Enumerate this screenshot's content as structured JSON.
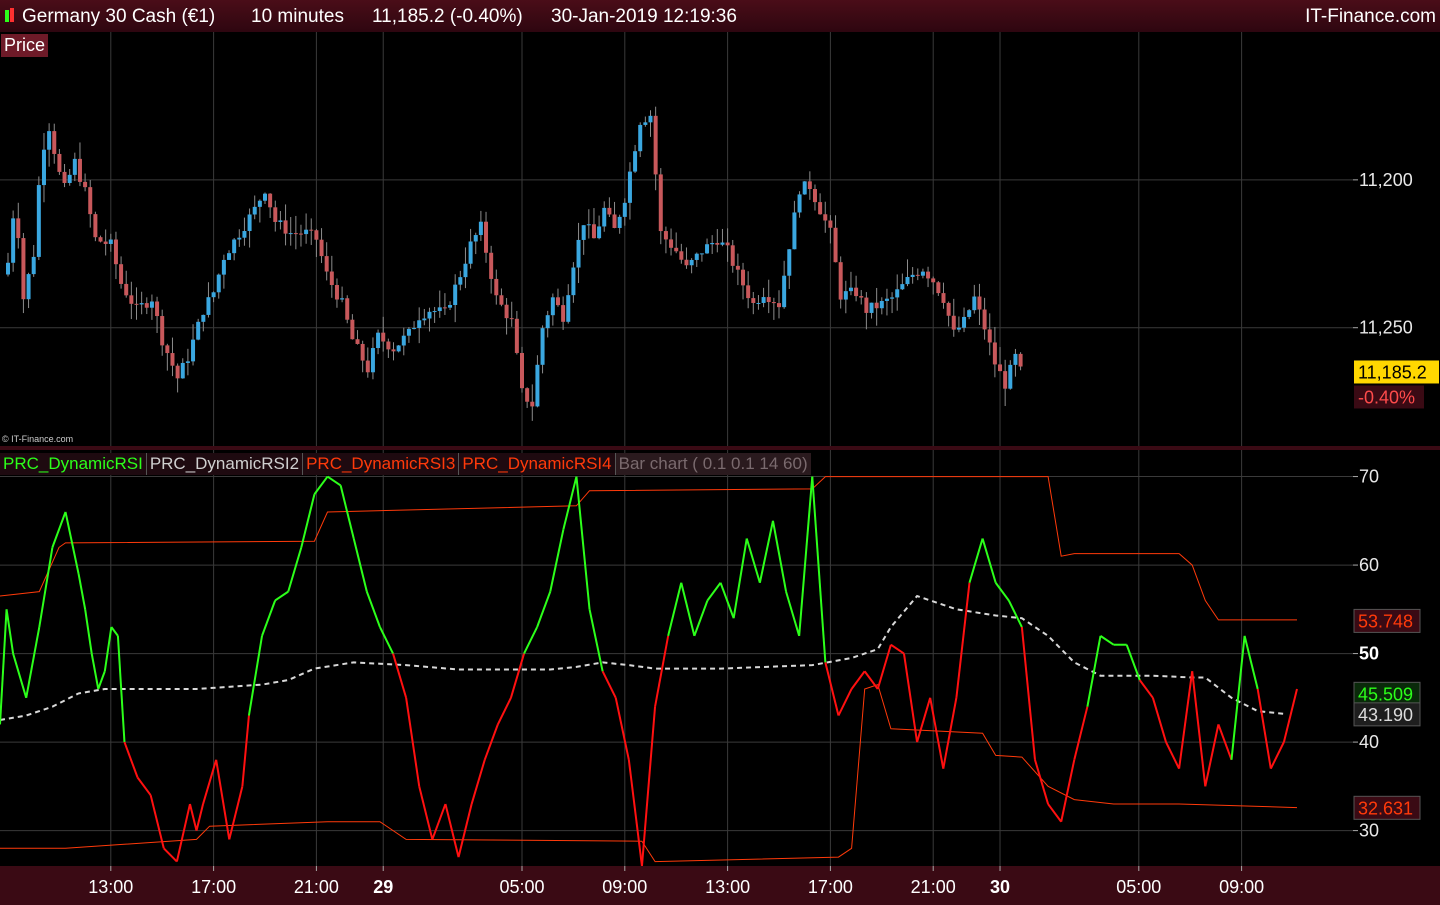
{
  "header": {
    "instrument": "Germany 30 Cash (€1)",
    "interval": "10 minutes",
    "last": "11,185.2 (-0.40%)",
    "datetime": "30-Jan-2019 12:19:36",
    "brand": "IT-Finance.com"
  },
  "price_panel": {
    "label": "Price",
    "watermark": "© IT-Finance.com",
    "axis_ticks": [
      "11,250",
      "11,200"
    ],
    "last_price_tag": "11,185.2",
    "change_tag": "-0.40%"
  },
  "indicator_panel": {
    "tabs": [
      "PRC_DynamicRSI",
      "PRC_DynamicRSI2",
      "PRC_DynamicRSI3",
      "PRC_DynamicRSI4",
      "Bar chart ( 0.1 0.1 14 60)"
    ],
    "axis_ticks": [
      "70",
      "60",
      "50",
      "40",
      "30"
    ],
    "value_tags": {
      "upper": "53.748",
      "rsi": "45.509",
      "mid": "43.190",
      "lower": "32.631"
    }
  },
  "x_axis": {
    "labels": [
      "13:00",
      "17:00",
      "21:00",
      "29",
      "05:00",
      "09:00",
      "13:00",
      "17:00",
      "21:00",
      "30",
      "05:00",
      "09:00"
    ],
    "bold": [
      false,
      false,
      false,
      true,
      false,
      false,
      false,
      false,
      false,
      true,
      false,
      false
    ]
  },
  "colors": {
    "up": "#3aa7e0",
    "down": "#c8585b",
    "wick": "#8c8c8c",
    "rsi_bull": "#2cff1a",
    "rsi_bear": "#ff1010",
    "band": "#ff3a0a",
    "mid": "#d8d8d8",
    "tag_last": "#ffd700",
    "tag_change": "#ff4b4b"
  },
  "chart_data": [
    {
      "type": "candlestick",
      "title": "Germany 30 Cash (€1)",
      "y_ticks": [
        11200,
        11250
      ],
      "ylim": [
        11160,
        11300
      ],
      "last": 11185.2,
      "change_pct": -0.4,
      "close_path": [
        [
          0,
          11222
        ],
        [
          1,
          11238
        ],
        [
          2,
          11232
        ],
        [
          3,
          11210
        ],
        [
          5,
          11225
        ],
        [
          6,
          11248
        ],
        [
          7,
          11262
        ],
        [
          8,
          11268
        ],
        [
          10,
          11252
        ],
        [
          11,
          11247
        ],
        [
          13,
          11256
        ],
        [
          15,
          11246
        ],
        [
          17,
          11230
        ],
        [
          20,
          11228
        ],
        [
          22,
          11215
        ],
        [
          25,
          11206
        ],
        [
          28,
          11210
        ],
        [
          30,
          11196
        ],
        [
          33,
          11183
        ],
        [
          35,
          11190
        ],
        [
          38,
          11206
        ],
        [
          40,
          11212
        ],
        [
          42,
          11224
        ],
        [
          45,
          11232
        ],
        [
          48,
          11240
        ],
        [
          50,
          11247
        ],
        [
          52,
          11236
        ],
        [
          55,
          11232
        ],
        [
          58,
          11232
        ],
        [
          60,
          11230
        ],
        [
          62,
          11218
        ],
        [
          65,
          11208
        ],
        [
          67,
          11196
        ],
        [
          70,
          11186
        ],
        [
          72,
          11197
        ],
        [
          75,
          11193
        ],
        [
          78,
          11198
        ],
        [
          80,
          11204
        ],
        [
          82,
          11206
        ],
        [
          85,
          11205
        ],
        [
          88,
          11218
        ],
        [
          90,
          11228
        ],
        [
          92,
          11234
        ],
        [
          95,
          11210
        ],
        [
          98,
          11202
        ],
        [
          100,
          11178
        ],
        [
          102,
          11174
        ],
        [
          104,
          11200
        ],
        [
          106,
          11210
        ],
        [
          108,
          11204
        ],
        [
          110,
          11222
        ],
        [
          112,
          11236
        ],
        [
          114,
          11230
        ],
        [
          116,
          11240
        ],
        [
          118,
          11233
        ],
        [
          120,
          11244
        ],
        [
          123,
          11270
        ],
        [
          125,
          11272
        ],
        [
          127,
          11232
        ],
        [
          130,
          11226
        ],
        [
          132,
          11220
        ],
        [
          135,
          11226
        ],
        [
          138,
          11230
        ],
        [
          140,
          11226
        ],
        [
          142,
          11218
        ],
        [
          145,
          11208
        ],
        [
          147,
          11212
        ],
        [
          150,
          11208
        ],
        [
          152,
          11228
        ],
        [
          154,
          11247
        ],
        [
          156,
          11248
        ],
        [
          158,
          11240
        ],
        [
          160,
          11232
        ],
        [
          162,
          11211
        ],
        [
          165,
          11212
        ],
        [
          167,
          11206
        ],
        [
          170,
          11208
        ],
        [
          172,
          11210
        ],
        [
          174,
          11214
        ],
        [
          176,
          11218
        ],
        [
          178,
          11220
        ],
        [
          180,
          11216
        ],
        [
          182,
          11210
        ],
        [
          184,
          11198
        ],
        [
          186,
          11202
        ],
        [
          188,
          11210
        ],
        [
          190,
          11200
        ],
        [
          192,
          11188
        ],
        [
          194,
          11181
        ],
        [
          196,
          11190
        ],
        [
          197,
          11185.2
        ]
      ]
    },
    {
      "type": "line",
      "title": "PRC_DynamicRSI",
      "y_ticks": [
        30,
        40,
        50,
        60,
        70
      ],
      "ylim": [
        26,
        73
      ],
      "series": [
        {
          "name": "PRC_DynamicRSI",
          "role": "rsi",
          "values": [
            [
              0,
              42
            ],
            [
              1,
              55
            ],
            [
              2,
              50
            ],
            [
              4,
              45
            ],
            [
              6,
              53
            ],
            [
              8,
              62
            ],
            [
              10,
              66
            ],
            [
              12,
              59
            ],
            [
              13,
              55
            ],
            [
              14,
              50
            ],
            [
              15,
              46
            ],
            [
              16,
              48
            ],
            [
              17,
              53
            ],
            [
              18,
              52
            ],
            [
              19,
              40
            ],
            [
              21,
              36
            ],
            [
              23,
              34
            ],
            [
              25,
              28
            ],
            [
              27,
              26.5
            ],
            [
              29,
              33
            ],
            [
              30,
              30
            ],
            [
              31,
              33
            ],
            [
              33,
              38
            ],
            [
              35,
              29
            ],
            [
              37,
              35
            ],
            [
              38,
              43
            ],
            [
              40,
              52
            ],
            [
              42,
              56
            ],
            [
              44,
              57
            ],
            [
              46,
              62
            ],
            [
              48,
              68
            ],
            [
              50,
              70
            ],
            [
              52,
              69
            ],
            [
              54,
              63
            ],
            [
              56,
              57
            ],
            [
              58,
              53
            ],
            [
              60,
              50
            ],
            [
              62,
              45
            ],
            [
              64,
              35
            ],
            [
              66,
              29
            ],
            [
              68,
              33
            ],
            [
              70,
              27
            ],
            [
              72,
              33
            ],
            [
              74,
              38
            ],
            [
              76,
              42
            ],
            [
              78,
              45
            ],
            [
              80,
              50
            ],
            [
              82,
              53
            ],
            [
              84,
              57
            ],
            [
              86,
              64
            ],
            [
              88,
              70
            ],
            [
              90,
              55
            ],
            [
              92,
              48
            ],
            [
              94,
              45
            ],
            [
              96,
              38
            ],
            [
              98,
              26
            ],
            [
              100,
              44
            ],
            [
              102,
              52
            ],
            [
              104,
              58
            ],
            [
              106,
              52
            ],
            [
              108,
              56
            ],
            [
              110,
              58
            ],
            [
              112,
              54
            ],
            [
              114,
              63
            ],
            [
              116,
              58
            ],
            [
              118,
              65
            ],
            [
              120,
              57
            ],
            [
              122,
              52
            ],
            [
              124,
              70
            ],
            [
              126,
              49
            ],
            [
              128,
              43
            ],
            [
              130,
              46
            ],
            [
              132,
              48
            ],
            [
              134,
              46
            ],
            [
              136,
              51
            ],
            [
              138,
              50
            ],
            [
              140,
              40
            ],
            [
              142,
              45
            ],
            [
              144,
              37
            ],
            [
              146,
              45
            ],
            [
              148,
              58
            ],
            [
              150,
              63
            ],
            [
              152,
              58
            ],
            [
              154,
              56
            ],
            [
              156,
              53
            ],
            [
              158,
              38
            ],
            [
              160,
              33
            ],
            [
              162,
              31
            ],
            [
              164,
              38
            ],
            [
              166,
              44
            ],
            [
              168,
              52
            ],
            [
              170,
              51
            ],
            [
              172,
              51
            ],
            [
              174,
              47
            ],
            [
              176,
              45
            ],
            [
              178,
              40
            ],
            [
              180,
              37
            ],
            [
              182,
              48
            ],
            [
              184,
              35
            ],
            [
              186,
              42
            ],
            [
              188,
              38
            ],
            [
              190,
              52
            ],
            [
              192,
              46
            ],
            [
              194,
              37
            ],
            [
              196,
              40
            ],
            [
              198,
              46
            ]
          ]
        },
        {
          "name": "PRC_DynamicRSI2",
          "role": "mid",
          "values": [
            [
              0,
              42.5
            ],
            [
              4,
              43
            ],
            [
              8,
              44
            ],
            [
              12,
              45.5
            ],
            [
              16,
              46
            ],
            [
              20,
              46
            ],
            [
              30,
              46
            ],
            [
              40,
              46.5
            ],
            [
              44,
              47
            ],
            [
              48,
              48.3
            ],
            [
              54,
              49
            ],
            [
              62,
              48.7
            ],
            [
              70,
              48.2
            ],
            [
              84,
              48.2
            ],
            [
              88,
              48.5
            ],
            [
              92,
              49
            ],
            [
              96,
              48.7
            ],
            [
              100,
              48.3
            ],
            [
              110,
              48.3
            ],
            [
              124,
              48.7
            ],
            [
              130,
              49.5
            ],
            [
              134,
              50.5
            ],
            [
              136,
              53
            ],
            [
              140,
              56.5
            ],
            [
              146,
              55
            ],
            [
              152,
              54.3
            ],
            [
              156,
              54
            ],
            [
              160,
              52
            ],
            [
              164,
              49
            ],
            [
              168,
              47.5
            ],
            [
              176,
              47.5
            ],
            [
              182,
              47.3
            ],
            [
              184,
              47.3
            ],
            [
              188,
              45
            ],
            [
              192,
              43.5
            ],
            [
              196,
              43.2
            ]
          ]
        },
        {
          "name": "PRC_DynamicRSI3",
          "role": "upper",
          "values": [
            [
              0,
              56.5
            ],
            [
              6,
              57
            ],
            [
              9,
              62
            ],
            [
              10,
              62.5
            ],
            [
              48,
              62.7
            ],
            [
              50,
              66
            ],
            [
              88,
              66.7
            ],
            [
              90,
              68.4
            ],
            [
              124,
              68.6
            ],
            [
              126,
              70
            ],
            [
              160,
              70
            ],
            [
              162,
              61
            ],
            [
              164,
              61.3
            ],
            [
              180,
              61.3
            ],
            [
              182,
              60
            ],
            [
              184,
              56
            ],
            [
              186,
              53.8
            ],
            [
              198,
              53.8
            ]
          ]
        },
        {
          "name": "PRC_DynamicRSI4",
          "role": "lower",
          "values": [
            [
              0,
              28
            ],
            [
              10,
              28
            ],
            [
              30,
              29
            ],
            [
              32,
              30.5
            ],
            [
              50,
              31
            ],
            [
              58,
              31
            ],
            [
              62,
              29
            ],
            [
              98,
              28.8
            ],
            [
              100,
              26.5
            ],
            [
              128,
              27
            ],
            [
              130,
              28
            ],
            [
              132,
              46
            ],
            [
              134,
              46.5
            ],
            [
              136,
              41.5
            ],
            [
              150,
              41
            ],
            [
              152,
              38.5
            ],
            [
              156,
              38.3
            ],
            [
              160,
              35
            ],
            [
              164,
              33.5
            ],
            [
              170,
              33
            ],
            [
              180,
              33
            ],
            [
              198,
              32.6
            ]
          ]
        }
      ],
      "last_values": {
        "PRC_DynamicRSI": 45.509,
        "PRC_DynamicRSI2": 43.19,
        "PRC_DynamicRSI3": 53.748,
        "PRC_DynamicRSI4": 32.631
      }
    }
  ]
}
